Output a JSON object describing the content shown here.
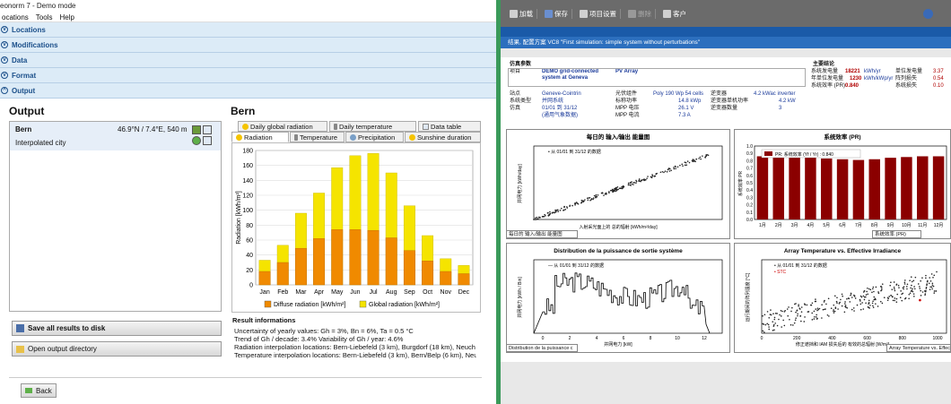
{
  "left_app": {
    "title": "eonorm 7 - Demo mode",
    "menu": [
      "ocations",
      "Tools",
      "Help"
    ],
    "sections": [
      "Locations",
      "Modifications",
      "Data",
      "Format",
      "Output"
    ],
    "output_heading": "Output",
    "location": {
      "name": "Bern",
      "coords": "46.9°N / 7.4°E, 540 m",
      "source": "Interpolated city"
    },
    "save_button": "Save all results to disk",
    "open_button": "Open output directory",
    "back_button": "Back",
    "chart_heading": "Bern",
    "tabs_top": [
      "Daily global radiation",
      "Daily temperature",
      "Data table"
    ],
    "tabs_bottom": [
      "Radiation",
      "Temperature",
      "Precipitation",
      "Sunshine duration"
    ],
    "result_heading": "Result informations",
    "result_lines": [
      "Uncertainty of yearly values: Gh = 3%, Bn = 6%, Ta = 0.5 °C",
      "Trend of Gh / decade: 3.4%   Variability of Gh / year: 4.6%",
      "Radiation interpolation locations: Bern-Liebefeld (3 km), Burgdorf (18 km), Neuch",
      "Temperature interpolation locations: Bern-Liebefeld (3 km), Bern/Belp (6 km), Neu"
    ]
  },
  "chart_data": {
    "type": "bar",
    "title": "",
    "ylabel": "Radiation [kWh/m²]",
    "xlabel": "",
    "ylim": [
      0,
      180
    ],
    "yticks": [
      0,
      20,
      40,
      60,
      80,
      100,
      120,
      140,
      160,
      180
    ],
    "categories": [
      "Jan",
      "Feb",
      "Mar",
      "Apr",
      "May",
      "Jun",
      "Jul",
      "Aug",
      "Sep",
      "Oct",
      "Nov",
      "Dec"
    ],
    "series": [
      {
        "name": "Diffuse radiation [kWh/m²]",
        "color": "#f08a00",
        "values": [
          18,
          30,
          49,
          62,
          74,
          74,
          73,
          63,
          46,
          32,
          18,
          15
        ]
      },
      {
        "name": "Global radiation [kWh/m²]",
        "color": "#f5e400",
        "values": [
          33,
          53,
          96,
          123,
          157,
          173,
          176,
          150,
          106,
          66,
          35,
          26
        ]
      }
    ],
    "grid": true,
    "legend": "bottom"
  },
  "right_app": {
    "toolbar": [
      "加载",
      "保存",
      "项目设置",
      "删除",
      "客户"
    ],
    "window_title": "结果, 配置方案 VC8  \"First simulation: simple system without perturbations\"",
    "sim_params_label": "仿真参数",
    "project_label": "项目",
    "project_value": "DEMO grid-connected system at Geneva",
    "pv_array": "PV Array",
    "site_label": "站点",
    "site_value": "Geneve-Cointrin",
    "systype_label": "系统类型",
    "systype_value": "并网系统",
    "sim_label": "仿真",
    "sim_value": "01/01 到 31/12",
    "sim_sub": "(通用气象数据)",
    "module_label": "光伏组件",
    "module_value": "Poly 190 Wp  54 cells",
    "nominal_label": "标称功率",
    "nominal_value": "14.8 kWp",
    "mppv_label": "MPP 电压",
    "mppv_value": "26.1 V",
    "mppi_label": "MPP 电流",
    "mppi_value": "7.3 A",
    "inv_label": "逆变器",
    "inv_value": "4.2 kWac inverter",
    "invp_label": "逆变器单机功率",
    "invp_value": "4.2 kW",
    "invn_label": "逆变器数量",
    "invn_value": "3",
    "main_results": "主要结论",
    "prod_label": "系统发电量",
    "prod_value": "18221",
    "prod_unit": "kWh/yr",
    "spec_label": "年单位发电量",
    "spec_value": "1230",
    "spec_unit": "kWh/kWp/yr",
    "pr_label": "系统效率 (PR)",
    "pr_value": "0.840",
    "unit_prod": "单位发电量",
    "array_loss": "阵列损失",
    "sys_loss": "系统损失",
    "unit_prod_v": "3.37",
    "array_loss_v": "0.54",
    "sys_loss_v": "0.10",
    "chart1": {
      "title": "每日的 输入/输出 能量图",
      "legend": "从 01/01 到 31/12 的数据",
      "xlabel": "入射采光面上的 总的辐射  [kWh/m²/day]",
      "ylabel": "并网电力 [kWh/day]",
      "select": "每日的 输入/输出 能量图",
      "x": [
        0,
        1,
        2,
        3,
        4,
        5,
        6,
        7,
        8,
        9
      ],
      "y": [
        0,
        5,
        10,
        16,
        21,
        27,
        32,
        38,
        43,
        48
      ]
    },
    "chart2": {
      "title": "系统效率 (PR)",
      "legend": "PR: 系统效率 (Yf / Yr) : 0.840",
      "ylabel": "系统效率 PR",
      "select": "系统效率 (PR)",
      "categories": [
        "1月",
        "2月",
        "3月",
        "4月",
        "5月",
        "6月",
        "7月",
        "8月",
        "9月",
        "10月",
        "11月",
        "12月"
      ],
      "values": [
        0.86,
        0.86,
        0.86,
        0.85,
        0.83,
        0.82,
        0.81,
        0.82,
        0.84,
        0.85,
        0.86,
        0.86
      ],
      "yticks": [
        "0.0",
        "0.1",
        "0.2",
        "0.3",
        "0.4",
        "0.5",
        "0.6",
        "0.7",
        "0.8",
        "0.9",
        "1.0"
      ]
    },
    "chart3": {
      "title": "Distribution de la puissance de sortie système",
      "legend": "从 01/01 到 31/12 的数据",
      "xlabel": "并网电力 [kW]",
      "ylabel": "并网电力  [kWh / Bin]",
      "select": "Distribution de la puissance c",
      "xticks": [
        "0",
        "2",
        "4",
        "6",
        "8",
        "10",
        "12"
      ]
    },
    "chart4": {
      "title": "Array Temperature vs. Effective Irradiance",
      "legend1": "从 01/01 到 31/12 的数据",
      "legend2": "STC",
      "xlabel": "修正遮挡和 IAM 损失后的 有效的总辐射 [W/m²]",
      "ylabel": "运行期间的阵列温度 [°C]",
      "select": "Array Temperature vs. Effec",
      "xticks": [
        "0",
        "200",
        "400",
        "600",
        "800",
        "1000"
      ]
    }
  },
  "colors": {
    "accordion_bg": "#dcebf7",
    "accordion_text": "#1b4f8a",
    "divider": "#3a9a5a",
    "pr_bar": "#8b0000"
  }
}
